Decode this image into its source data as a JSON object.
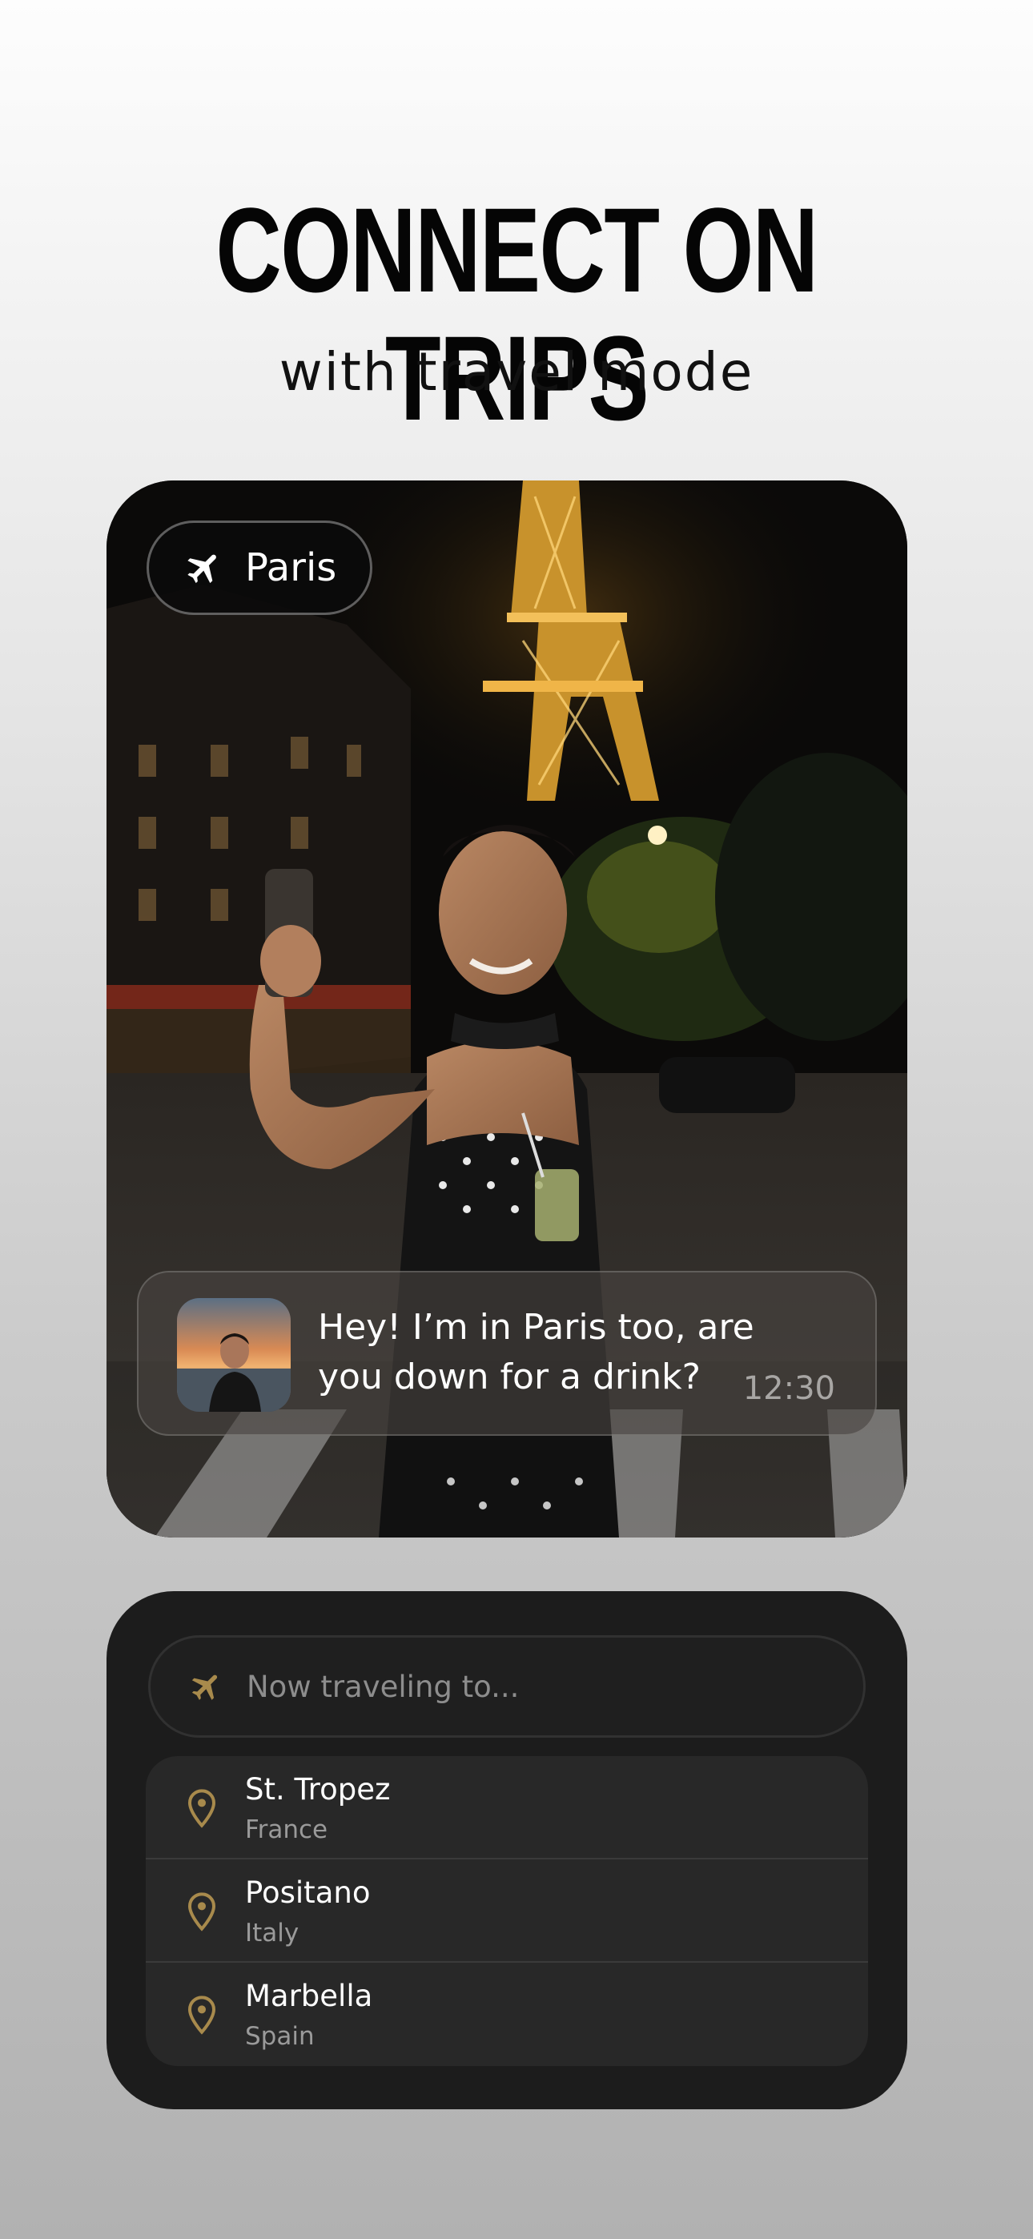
{
  "headline": "CONNECT ON TRIPS",
  "subheadline": "with travel mode",
  "photo_card": {
    "location_badge": {
      "icon": "airplane-icon",
      "label": "Paris"
    },
    "message": {
      "text": "Hey! I’m in Paris too, are you down for a drink?",
      "time": "12:30"
    }
  },
  "travel_panel": {
    "search": {
      "icon": "airplane-icon",
      "placeholder": "Now traveling to..."
    },
    "destinations": [
      {
        "icon": "map-pin-icon",
        "city": "St. Tropez",
        "country": "France"
      },
      {
        "icon": "map-pin-icon",
        "city": "Positano",
        "country": "Italy"
      },
      {
        "icon": "map-pin-icon",
        "city": "Marbella",
        "country": "Spain"
      }
    ]
  },
  "colors": {
    "accent_gold": "#a88a4c",
    "panel_dark": "#1c1c1c",
    "list_bg": "#282828"
  }
}
